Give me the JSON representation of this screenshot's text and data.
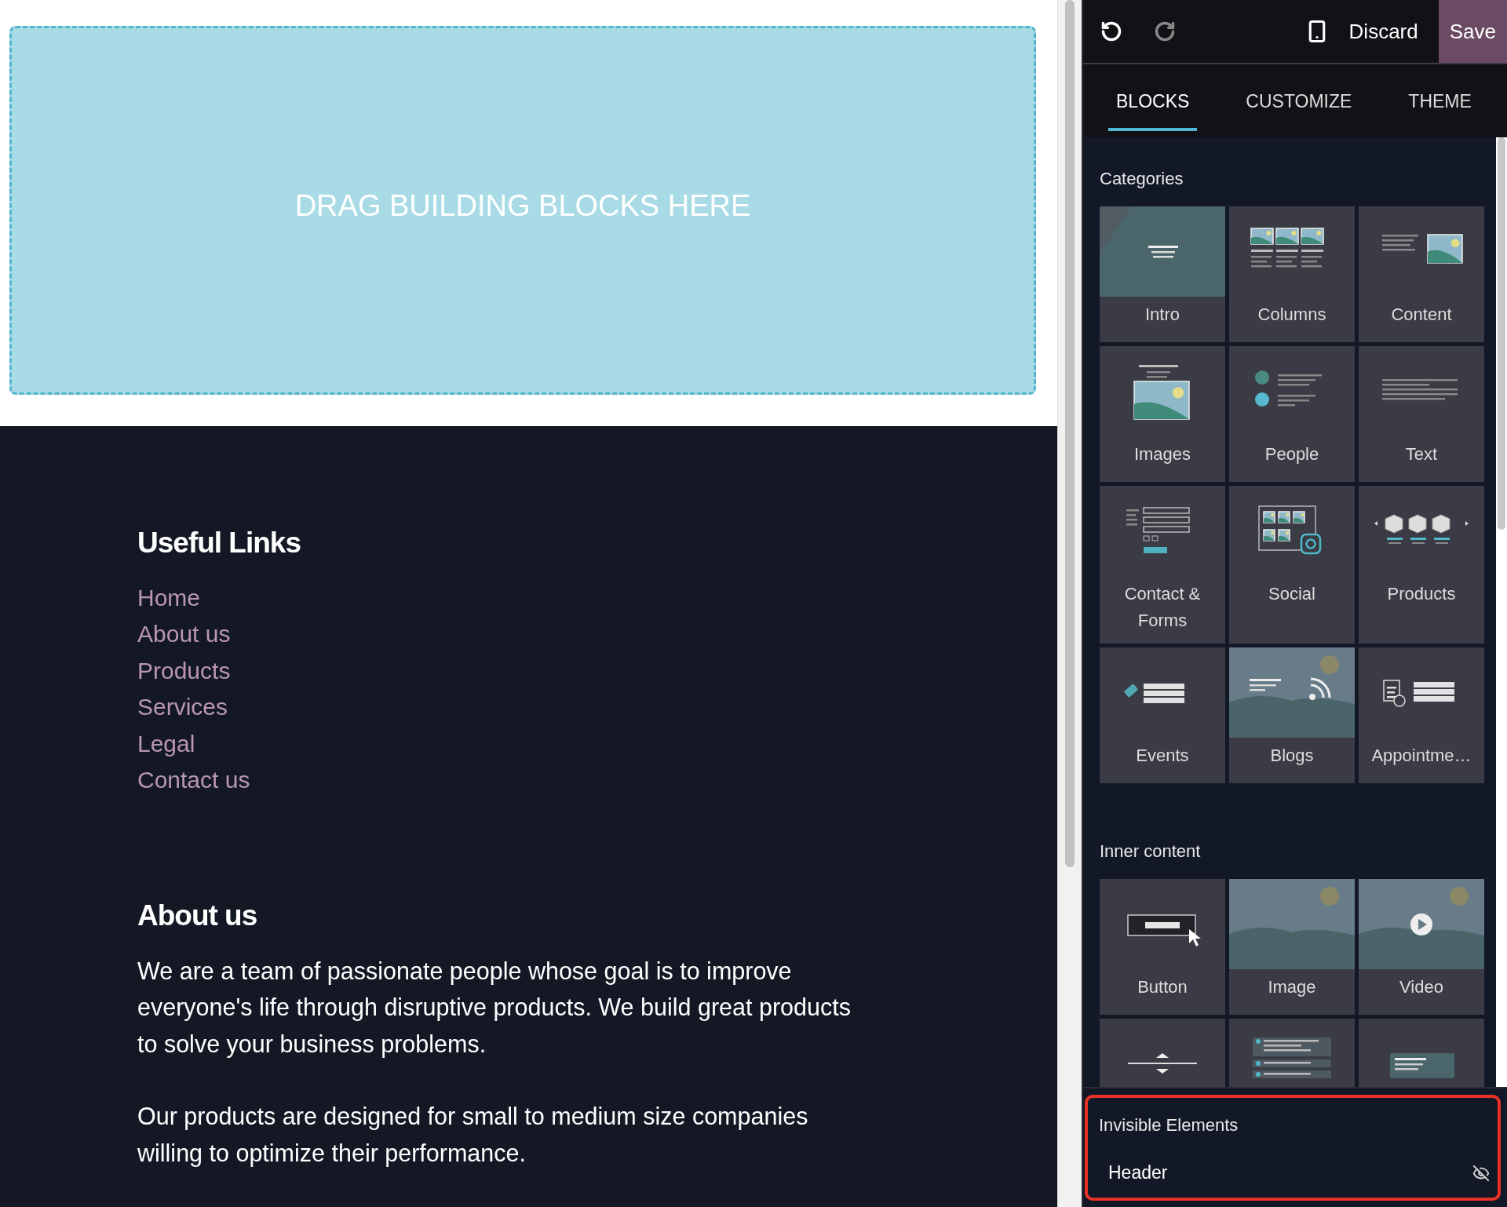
{
  "toolbar": {
    "undo": {
      "disabled": false
    },
    "redo": {
      "disabled": true
    },
    "discard": "Discard",
    "save": "Save"
  },
  "tabs": [
    {
      "label": "BLOCKS",
      "selected": true
    },
    {
      "label": "CUSTOMIZE",
      "selected": false
    },
    {
      "label": "THEME",
      "selected": false
    }
  ],
  "canvas": {
    "dropzone": "DRAG BUILDING BLOCKS HERE",
    "footer": {
      "links_title": "Useful Links",
      "links": [
        "Home",
        "About us",
        "Products",
        "Services",
        "Legal",
        "Contact us"
      ],
      "about_title": "About us",
      "paragraphs": [
        "We are a team of passionate people whose goal is to improve everyone's life through disruptive products. We build great products to solve your business problems.",
        "Our products are designed for small to medium size companies willing to optimize their performance."
      ]
    }
  },
  "categories": {
    "title": "Categories",
    "tiles": [
      {
        "label": "Intro",
        "kind": "intro"
      },
      {
        "label": "Columns",
        "kind": "columns"
      },
      {
        "label": "Content",
        "kind": "content"
      },
      {
        "label": "Images",
        "kind": "images"
      },
      {
        "label": "People",
        "kind": "people"
      },
      {
        "label": "Text",
        "kind": "text"
      },
      {
        "label": "Contact & Forms",
        "kind": "contact"
      },
      {
        "label": "Social",
        "kind": "social"
      },
      {
        "label": "Products",
        "kind": "products"
      },
      {
        "label": "Events",
        "kind": "events"
      },
      {
        "label": "Blogs",
        "kind": "blogs"
      },
      {
        "label": "Appointme…",
        "kind": "appointments"
      }
    ]
  },
  "inner_content": {
    "title": "Inner content",
    "tiles": [
      {
        "label": "Button",
        "kind": "button"
      },
      {
        "label": "Image",
        "kind": "image"
      },
      {
        "label": "Video",
        "kind": "video"
      },
      {
        "kind": "separator"
      },
      {
        "kind": "list"
      },
      {
        "kind": "card"
      }
    ]
  },
  "invisible_elements": {
    "title": "Invisible Elements",
    "highlighted": true,
    "items": [
      {
        "label": "Header",
        "visible": false
      }
    ]
  }
}
